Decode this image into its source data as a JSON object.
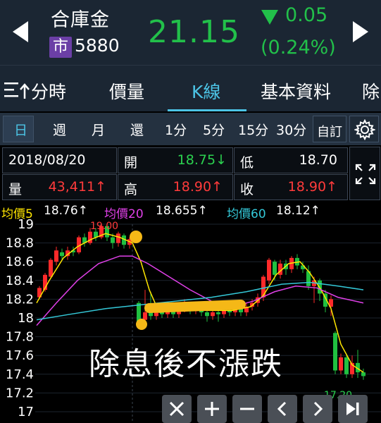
{
  "header": {
    "stock_name": "合庫金",
    "market_badge": "市",
    "stock_code": "5880",
    "price": "21.15",
    "change": "0.05",
    "change_percent": "(0.24%)",
    "price_color": "#22c04a"
  },
  "tabs": [
    {
      "label": "分時",
      "icon": "menu-up-arrow-icon"
    },
    {
      "label": "價量"
    },
    {
      "label": "K線",
      "active": true
    },
    {
      "label": "基本資料"
    },
    {
      "label": "除"
    }
  ],
  "periods": [
    "日",
    "週",
    "月",
    "還",
    "1分",
    "5分",
    "15分",
    "30分"
  ],
  "custom_label": "自訂",
  "info": {
    "date": "2018/08/20",
    "open_label": "開",
    "open_value": "18.75↓",
    "low_label": "低",
    "low_value": "18.70",
    "volume_label": "量",
    "volume_value": "43,411↑",
    "high_label": "高",
    "high_value": "18.90↑",
    "close_label": "收",
    "close_value": "18.90↑"
  },
  "moving_averages": [
    {
      "label": "均價5",
      "value": "18.76↑",
      "color": "#ffe600"
    },
    {
      "label": "均價20",
      "value": "18.655↑",
      "color": "#e040e8"
    },
    {
      "label": "均價60",
      "value": "18.12↑",
      "color": "#34c8d8"
    }
  ],
  "chart_data": {
    "type": "candlestick",
    "y_axis_ticks": [
      "19",
      "18.8",
      "18.6",
      "18.4",
      "18.2",
      "18",
      "17.8",
      "17.6",
      "17.4",
      "17.2",
      "17"
    ],
    "ylim": [
      17,
      19
    ],
    "annotations": {
      "high": "19.00",
      "low": "17.20"
    },
    "series": [
      {
        "name": "均價5",
        "color": "#ffe600"
      },
      {
        "name": "均價20",
        "color": "#e040e8"
      },
      {
        "name": "均價60",
        "color": "#34c8d8"
      }
    ]
  },
  "caption": "除息後不漲跌",
  "toolbar": [
    "close-icon",
    "plus-icon",
    "minus-icon",
    "chevron-left-icon",
    "chevron-right-icon",
    "skip-to-end-icon"
  ]
}
